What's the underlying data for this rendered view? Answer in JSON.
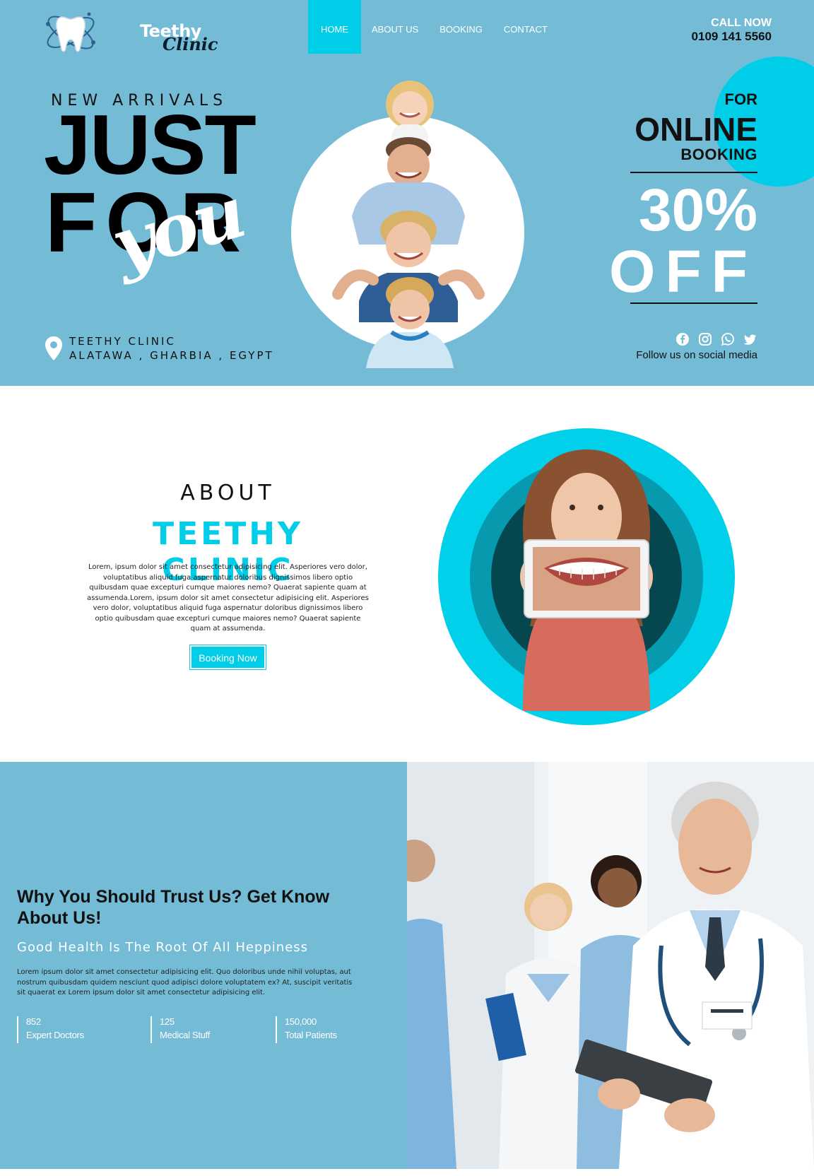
{
  "header": {
    "logo": {
      "word1": "Teethy",
      "word2": "Clinic"
    },
    "nav": [
      {
        "label": "HOME"
      },
      {
        "label": "ABOUT US"
      },
      {
        "label": "BOOKING"
      },
      {
        "label": "CONTACT"
      }
    ],
    "call_label": "CALL NOW",
    "phone": "0109 141 5560"
  },
  "hero": {
    "eyebrow": "NEW ARRIVALS",
    "headline_1": "JUST",
    "headline_2": "FOR",
    "script_word": "you",
    "promo": {
      "line1": "FOR",
      "line2": "ONLINE",
      "line3": "BOOKING",
      "percent": "30%",
      "off": "OFF"
    },
    "location": {
      "name": "TEETHY CLINIC",
      "address": "ALATAWA , GHARBIA , EGYPT"
    },
    "social": {
      "icons": [
        "facebook-icon",
        "instagram-icon",
        "whatsapp-icon",
        "twitter-icon"
      ],
      "caption": "Follow us on social media"
    }
  },
  "about": {
    "label": "ABOUT",
    "title": "TEETHY CLINIC",
    "text": "Lorem, ipsum dolor sit amet consectetur adipisicing elit. Asperiores vero dolor, voluptatibus aliquid fuga aspernatur doloribus dignissimos libero optio quibusdam quae excepturi cumque maiores nemo? Quaerat sapiente quam at assumenda.Lorem, ipsum dolor sit amet consectetur adipisicing elit. Asperiores vero dolor, voluptatibus aliquid fuga aspernatur doloribus dignissimos libero optio quibusdam quae excepturi cumque maiores nemo? Quaerat sapiente quam at assumenda.",
    "button": "Booking Now"
  },
  "trust": {
    "title": "Why You Should Trust Us? Get Know About Us!",
    "subtitle": "Good Health Is The Root Of All Heppiness",
    "text": "Lorem ipsum dolor sit amet consectetur adipisicing elit. Quo doloribus unde nihil voluptas, aut nostrum quibusdam quidem nesciunt quod adipisci dolore voluptatem ex? At, suscipit veritatis sit quaerat ex Lorem ipsum dolor sit amet consectetur adipisicing elit.",
    "stats": [
      {
        "number": "852",
        "label": "Expert Doctors"
      },
      {
        "number": "125",
        "label": "Medical Stuff"
      },
      {
        "number": "150,000",
        "label": "Total Patients"
      }
    ]
  },
  "colors": {
    "hero_bg": "#74bcd6",
    "accent": "#00cde8",
    "dark": "#111111",
    "white": "#ffffff"
  }
}
